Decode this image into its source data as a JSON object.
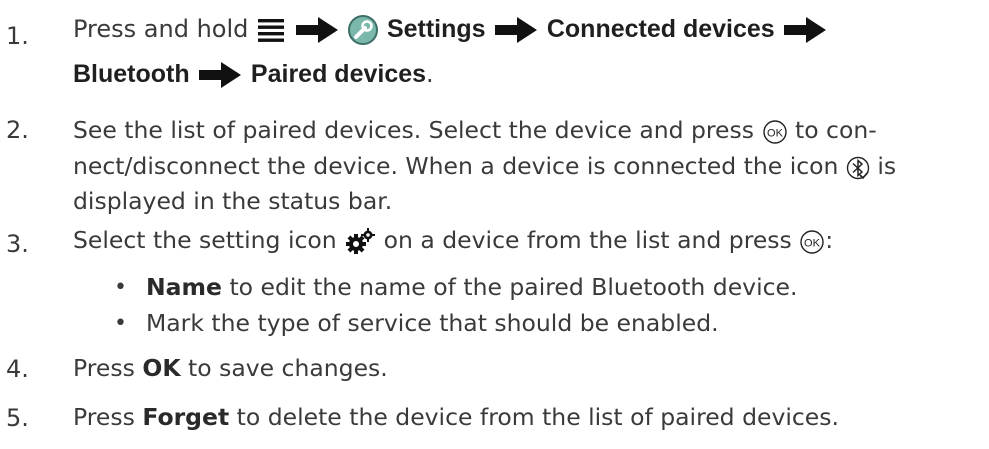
{
  "steps": [
    {
      "number": "1.",
      "parts": {
        "a": "Press and hold",
        "settings": "Settings",
        "connected": "Connected devices",
        "bluetooth": "Bluetooth",
        "paired": "Paired devices",
        "end": "."
      },
      "icons": [
        "menu-icon",
        "arrow-right-icon",
        "wrench-icon",
        "arrow-right-icon",
        "arrow-right-icon",
        "arrow-right-icon"
      ]
    },
    {
      "number": "2.",
      "line1_a": "See the list of paired devices. Select the device and press",
      "line1_b": "to con-",
      "line2_a": "nect/disconnect the device. When a device is connected the icon",
      "line2_b": "is",
      "line3": "displayed in the status bar.",
      "icons": [
        "ok-icon",
        "bluetooth-connected-icon"
      ]
    },
    {
      "number": "3.",
      "a": "Select the setting icon",
      "b": "on a device from the list and press",
      "c": ":",
      "icons": [
        "gear-icon",
        "ok-icon"
      ],
      "bullets": [
        {
          "bold": "Name",
          "rest": "to edit the name of the paired Bluetooth device."
        },
        {
          "bold": "",
          "rest": "Mark the type of service that should be enabled."
        }
      ]
    },
    {
      "number": "4.",
      "a": "Press",
      "bold": "OK",
      "b": "to save changes."
    },
    {
      "number": "5.",
      "a": "Press",
      "bold": "Forget",
      "b": "to delete the device from the list of paired devices."
    }
  ],
  "bullet_symbol": "•",
  "ok_glyph": "OK"
}
